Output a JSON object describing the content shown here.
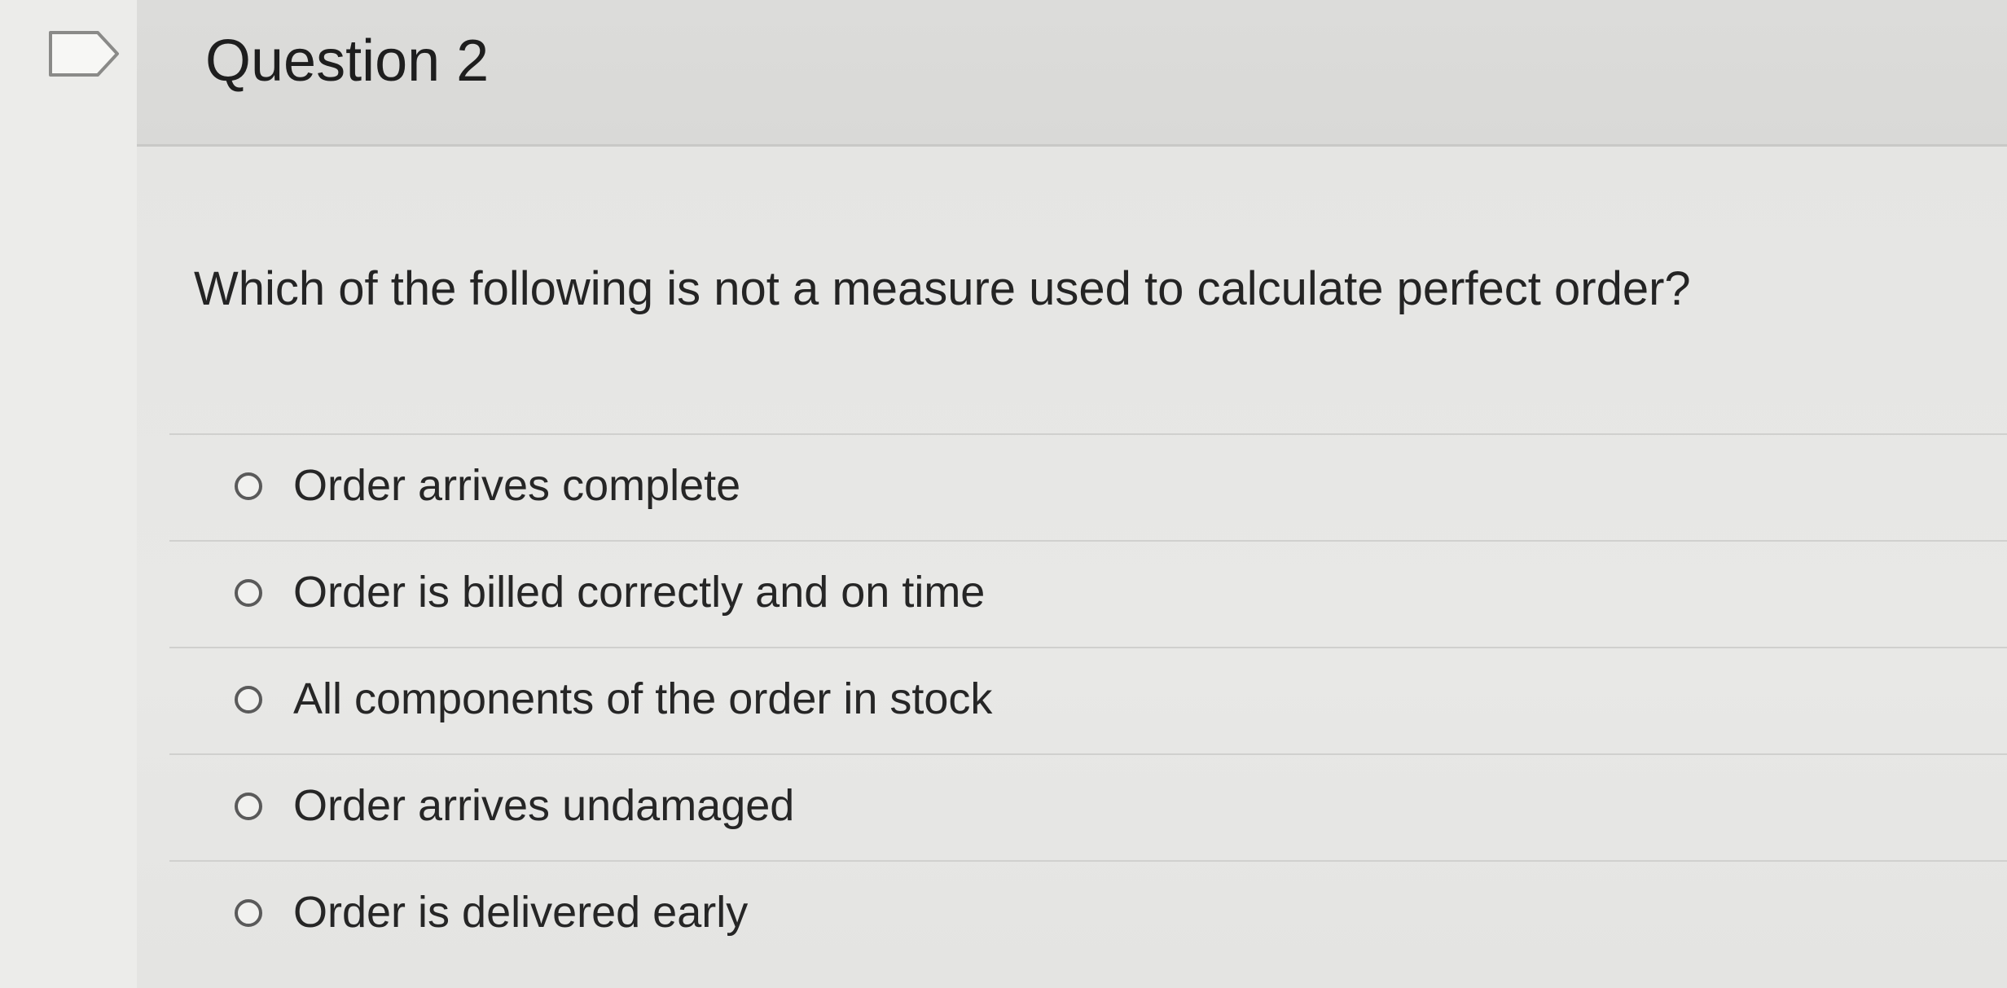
{
  "question": {
    "title": "Question 2",
    "prompt": "Which of the following is not a measure used to calculate perfect order?",
    "flag_icon": "flag-icon"
  },
  "answers": [
    {
      "label": "Order arrives complete",
      "selected": false
    },
    {
      "label": "Order is billed correctly and on time",
      "selected": false
    },
    {
      "label": "All components of the order in stock",
      "selected": false
    },
    {
      "label": "Order arrives undamaged",
      "selected": false
    },
    {
      "label": "Order is delivered early",
      "selected": false
    }
  ],
  "colors": {
    "background": "#e9e9e7",
    "header": "#dcdcda",
    "text": "#262626",
    "radio_border": "#5a5a5a"
  }
}
